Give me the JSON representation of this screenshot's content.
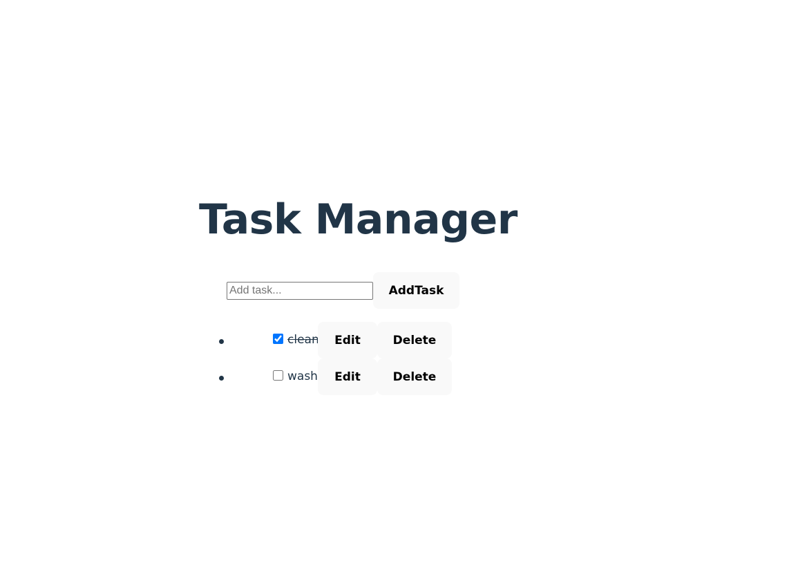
{
  "app": {
    "title": "Task Manager"
  },
  "add_form": {
    "input_value": "",
    "input_placeholder": "Add task...",
    "add_button_label": "AddTask"
  },
  "tasks": [
    {
      "text": "clean",
      "completed": true,
      "edit_label": "Edit",
      "delete_label": "Delete"
    },
    {
      "text": "wash",
      "completed": false,
      "edit_label": "Edit",
      "delete_label": "Delete"
    }
  ],
  "colors": {
    "text": "#213547",
    "button_bg": "#f9f9f9",
    "checkbox_accent": "#0075ff"
  }
}
